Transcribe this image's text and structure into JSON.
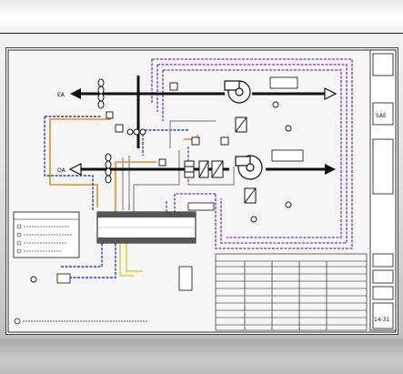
{
  "title_block": {
    "label_a": "SAE",
    "sheet_no": "14-31"
  },
  "legend": {
    "items": [
      {
        "label": ""
      },
      {
        "label": ""
      },
      {
        "label": ""
      },
      {
        "label": ""
      }
    ]
  },
  "duct_labels": {
    "exhaust": "EA",
    "outdoor": "OA"
  },
  "colors": {
    "duct": "#111111",
    "blue_wire": "#2a3fc8",
    "orange_wire": "#e09020",
    "purple_wire": "#8a55c8",
    "gray_wire": "#8a8a8a",
    "yellow_wire": "#d6c21a"
  },
  "icons": [
    "fan-icon",
    "damper-icon",
    "coil-icon",
    "filter-icon",
    "valve-icon",
    "arrow-icon"
  ]
}
